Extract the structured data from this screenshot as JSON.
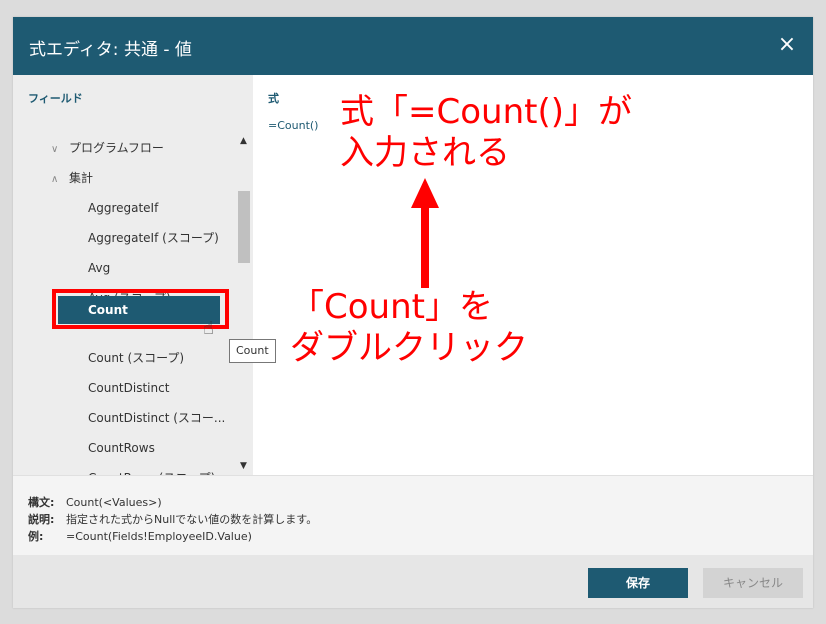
{
  "window": {
    "title": "式エディタ: 共通 - 値",
    "close_icon": "×"
  },
  "fields_panel": {
    "label": "フィールド",
    "groups": [
      {
        "label": "プログラムフロー",
        "chevron": "∨"
      },
      {
        "label": "集計",
        "chevron": "∧"
      }
    ],
    "items": [
      "AggregateIf",
      "AggregateIf (スコープ)",
      "Avg",
      "Avg (スコープ)",
      "Count",
      "Count (スコープ)",
      "CountDistinct",
      "CountDistinct (スコー...",
      "CountRows",
      "CountRows (スコープ)"
    ],
    "selected": "Count",
    "scroll_up": "▲",
    "scroll_down": "▼"
  },
  "expression_panel": {
    "label": "式",
    "value": "=Count()"
  },
  "info": {
    "syntax_label": "構文:",
    "syntax_value": "Count(<Values>)",
    "description_label": "説明:",
    "description_value": "指定された式からNullでない値の数を計算します。",
    "example_label": "例:",
    "example_value": "=Count(Fields!EmployeeID.Value)"
  },
  "tooltip": "Count",
  "buttons": {
    "save": "保存",
    "cancel": "キャンセル"
  },
  "annotations": {
    "top_line1": "式「=Count()」が",
    "top_line2": "入力される",
    "bottom_line1": "「Count」を",
    "bottom_line2": "ダブルクリック"
  },
  "colors": {
    "accent": "#1e5a72",
    "annotation": "#ff0000"
  }
}
